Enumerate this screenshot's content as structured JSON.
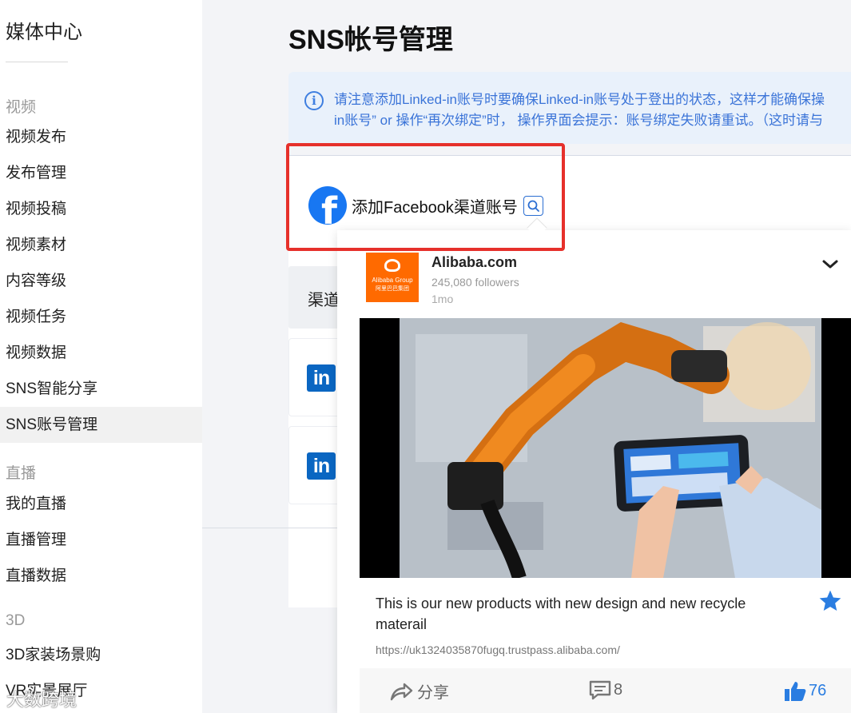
{
  "sidebar": {
    "title": "媒体中心",
    "sections": [
      {
        "label": "视频",
        "items": [
          "视频发布",
          "发布管理",
          "视频投稿",
          "视频素材",
          "内容等级",
          "视频任务",
          "视频数据",
          "SNS智能分享",
          "SNS账号管理"
        ]
      },
      {
        "label": "直播",
        "items": [
          "我的直播",
          "直播管理",
          "直播数据"
        ]
      },
      {
        "label": "3D",
        "items": [
          "3D家装场景购",
          "VR实景展厅"
        ]
      }
    ],
    "active_item": "SNS账号管理"
  },
  "page": {
    "title": "SNS帐号管理",
    "notice_line1": "请注意添加Linked-in账号时要确保Linked-in账号处于登出的状态，这样才能确保操",
    "notice_line2": "in账号” or 操作“再次绑定”时， 操作界面会提示：账号绑定失败请重试。（这时请与"
  },
  "add_channel": {
    "label": "添加Facebook渠道账号",
    "icon": "facebook-icon",
    "brand_color": "#1877f2"
  },
  "channel_table": {
    "header_partial": "渠道",
    "rows": [
      {
        "icon": "linkedin-icon",
        "logo_text": "in"
      },
      {
        "icon": "linkedin-icon",
        "logo_text": "in"
      }
    ]
  },
  "preview_popup": {
    "account_name": "Alibaba.com",
    "logo_brand": "Alibaba Group",
    "logo_sub": "阿里巴巴集团",
    "followers": "245,080 followers",
    "time": "1mo",
    "caption": "This is our new products with new design and new recycle materail",
    "link": "https://uk1324035870fugq.trustpass.alibaba.com/",
    "share_label": "分享",
    "comment_count": "8",
    "like_count": "76"
  },
  "watermark": "大数跨境",
  "colors": {
    "accent": "#2b6ed2",
    "highlight": "#e6302b",
    "linkedin": "#0a66c2",
    "alibaba": "#ff6a00",
    "notice_text": "#3b74d8",
    "like": "#2a7de1"
  }
}
